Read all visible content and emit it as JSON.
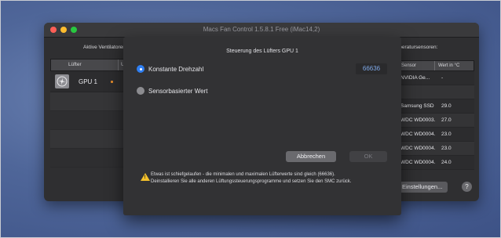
{
  "window": {
    "title": "Macs Fan Control 1.5.8.1 Free (iMac14,2)"
  },
  "main": {
    "fans_section": "Aktive Ventilatoren:",
    "sensors_section": "Temperatursensoren:",
    "fans_table": {
      "headers": [
        "Lüfter",
        "U/min"
      ],
      "rows": [
        {
          "name": "GPU 1"
        }
      ]
    },
    "sensors_table": {
      "headers": [
        "Sensor",
        "Wert in °C"
      ],
      "rows": [
        {
          "name": "NVIDIA Ge...",
          "value": "-"
        },
        {
          "name": "",
          "value": ""
        },
        {
          "name": "Samsung SSD ...",
          "value": "29.0"
        },
        {
          "name": "WDC WD0003...",
          "value": "27.0"
        },
        {
          "name": "WDC WD0004...",
          "value": "23.0"
        },
        {
          "name": "WDC WD0004...",
          "value": "23.0"
        },
        {
          "name": "WDC WD0004...",
          "value": "24.0"
        }
      ]
    },
    "preferences_button": "Einstellungen...",
    "help_button": "?"
  },
  "sheet": {
    "title": "Steuerung des Lüfters GPU 1",
    "option_constant": "Konstante Drehzahl",
    "option_sensor": "Sensorbasierter Wert",
    "rpm_value": "66636",
    "cancel_label": "Abbrechen",
    "ok_label": "OK",
    "warning_line1": "Etwas ist schiefgelaufen - die minimalen und maximalen Lüfterwerte sind gleich (66636).",
    "warning_line2": "Deinstallieren Sie alle anderen Lüftungssteuerungsprogramme und setzen Sie den SMC zurück.",
    "warning_icon": "warning-icon"
  }
}
